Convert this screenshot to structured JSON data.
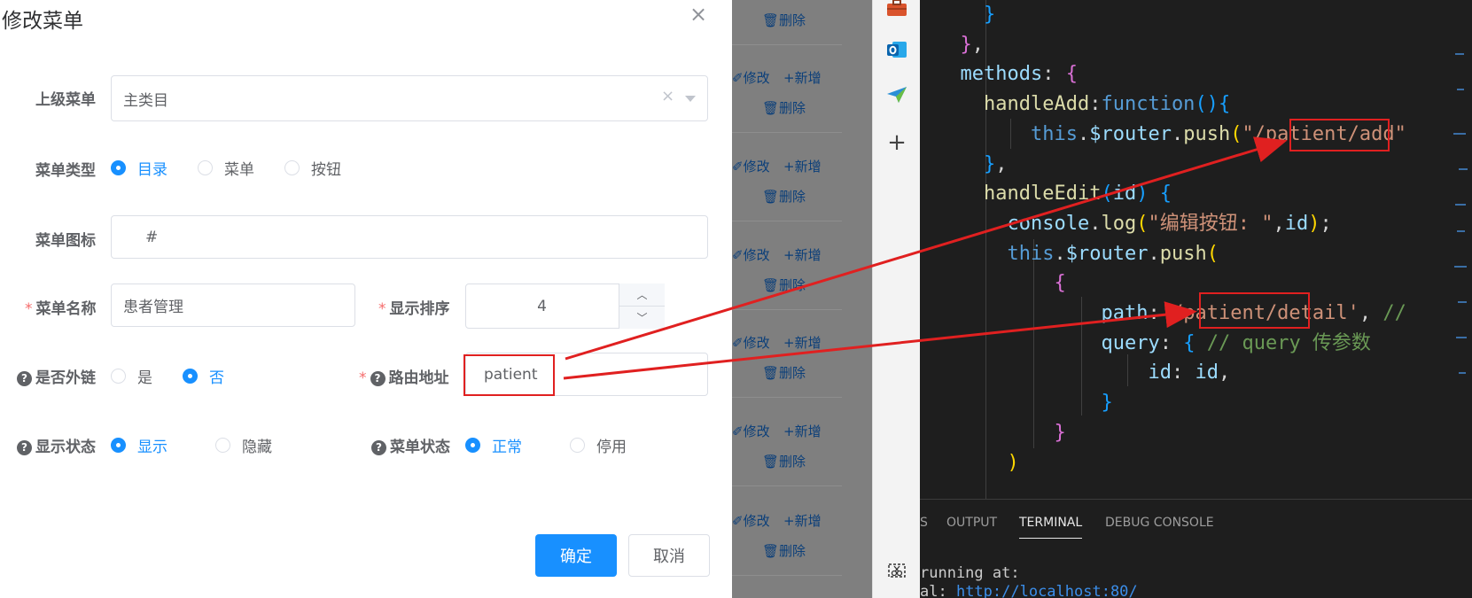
{
  "dialog": {
    "title": "修改菜单",
    "close_glyph": "×",
    "parent_menu": {
      "label": "上级菜单",
      "value": "主类目",
      "clear_glyph": "×"
    },
    "menu_type": {
      "label": "菜单类型",
      "options": [
        "目录",
        "菜单",
        "按钮"
      ],
      "selected": "目录"
    },
    "menu_icon": {
      "label": "菜单图标",
      "value": "#"
    },
    "menu_name": {
      "required": "*",
      "label": "菜单名称",
      "value": "患者管理"
    },
    "sort_order": {
      "required": "*",
      "label": "显示排序",
      "value": "4"
    },
    "external_link": {
      "label": "是否外链",
      "options": [
        "是",
        "否"
      ],
      "selected": "否"
    },
    "route_path": {
      "required": "*",
      "label": "路由地址",
      "value": "patient"
    },
    "visible": {
      "label": "显示状态",
      "options": [
        "显示",
        "隐藏"
      ],
      "selected": "显示"
    },
    "menu_status": {
      "label": "菜单状态",
      "options": [
        "正常",
        "停用"
      ],
      "selected": "正常"
    },
    "confirm_label": "确定",
    "cancel_label": "取消"
  },
  "background_table": {
    "delete_label": "删除",
    "edit_label": "修改",
    "add_label": "新增"
  },
  "editor": {
    "lines": [
      {
        "indent": 4,
        "tokens": [
          [
            "}",
            "br3"
          ]
        ]
      },
      {
        "indent": 3,
        "tokens": [
          [
            "}",
            "br2"
          ],
          [
            ",",
            "pl"
          ]
        ]
      },
      {
        "indent": 3,
        "tokens": [
          [
            "methods",
            "blue"
          ],
          [
            ": ",
            "pl"
          ],
          [
            "{",
            "br2"
          ]
        ]
      },
      {
        "indent": 4,
        "tokens": [
          [
            "handleAdd",
            "fn"
          ],
          [
            ":",
            "pl"
          ],
          [
            "function",
            "kw"
          ],
          [
            "()",
            "br3"
          ],
          [
            "{",
            "br3"
          ]
        ]
      },
      {
        "indent": 6,
        "tokens": [
          [
            "this",
            "kw"
          ],
          [
            ".",
            "pl"
          ],
          [
            "$router",
            "blue"
          ],
          [
            ".",
            "pl"
          ],
          [
            "push",
            "fn"
          ],
          [
            "(",
            "br1"
          ],
          [
            "\"/patient/add\"",
            "str"
          ]
        ]
      },
      {
        "indent": 4,
        "tokens": [
          [
            "}",
            "br3"
          ],
          [
            ",",
            "pl"
          ]
        ]
      },
      {
        "indent": 4,
        "tokens": [
          [
            "handleEdit",
            "fn"
          ],
          [
            "(",
            "br3"
          ],
          [
            "id",
            "blue"
          ],
          [
            ")",
            "br3"
          ],
          [
            " ",
            "pl"
          ],
          [
            "{",
            "br3"
          ]
        ]
      },
      {
        "indent": 5,
        "tokens": [
          [
            "console",
            "blue"
          ],
          [
            ".",
            "pl"
          ],
          [
            "log",
            "fn"
          ],
          [
            "(",
            "br1"
          ],
          [
            "\"编辑按钮: \"",
            "str"
          ],
          [
            ",",
            "pl"
          ],
          [
            "id",
            "blue"
          ],
          [
            ")",
            "br1"
          ],
          [
            ";",
            "pl"
          ]
        ]
      },
      {
        "indent": 5,
        "tokens": [
          [
            "this",
            "kw"
          ],
          [
            ".",
            "pl"
          ],
          [
            "$router",
            "blue"
          ],
          [
            ".",
            "pl"
          ],
          [
            "push",
            "fn"
          ],
          [
            "(",
            "br1"
          ]
        ]
      },
      {
        "indent": 7,
        "tokens": [
          [
            "{",
            "br2"
          ]
        ]
      },
      {
        "indent": 9,
        "tokens": [
          [
            "path",
            "blue"
          ],
          [
            ":",
            "pl"
          ],
          [
            "'/patient/detail'",
            "str"
          ],
          [
            ", ",
            "pl"
          ],
          [
            "//",
            "cmt"
          ]
        ]
      },
      {
        "indent": 9,
        "tokens": [
          [
            "query",
            "blue"
          ],
          [
            ": ",
            "pl"
          ],
          [
            "{",
            "br3"
          ],
          [
            " // query 传参数",
            "cmt"
          ]
        ]
      },
      {
        "indent": 11,
        "tokens": [
          [
            "id",
            "blue"
          ],
          [
            ": ",
            "pl"
          ],
          [
            "id",
            "blue"
          ],
          [
            ",",
            "pl"
          ]
        ]
      },
      {
        "indent": 9,
        "tokens": [
          [
            "}",
            "br3"
          ]
        ]
      },
      {
        "indent": 7,
        "tokens": [
          [
            "}",
            "br2"
          ]
        ]
      },
      {
        "indent": 5,
        "tokens": [
          [
            ")",
            "br1"
          ]
        ]
      }
    ]
  },
  "panel": {
    "tabs": [
      "S",
      "OUTPUT",
      "TERMINAL",
      "DEBUG CONSOLE"
    ],
    "active_tab": "TERMINAL",
    "terminal_line1": "running at:",
    "terminal_line2_prefix": "al:   ",
    "terminal_url": "http://localhost:80/"
  },
  "colors": {
    "primary": "#1890ff",
    "danger": "#f56c6c",
    "annotation_red": "#e02020",
    "editor_bg": "#1e1e1e"
  },
  "icons": [
    "toolbox-icon",
    "outlook-icon",
    "send-icon",
    "plus-icon",
    "screenshot-icon",
    "close-icon",
    "question-icon",
    "trash-icon",
    "edit-icon"
  ]
}
